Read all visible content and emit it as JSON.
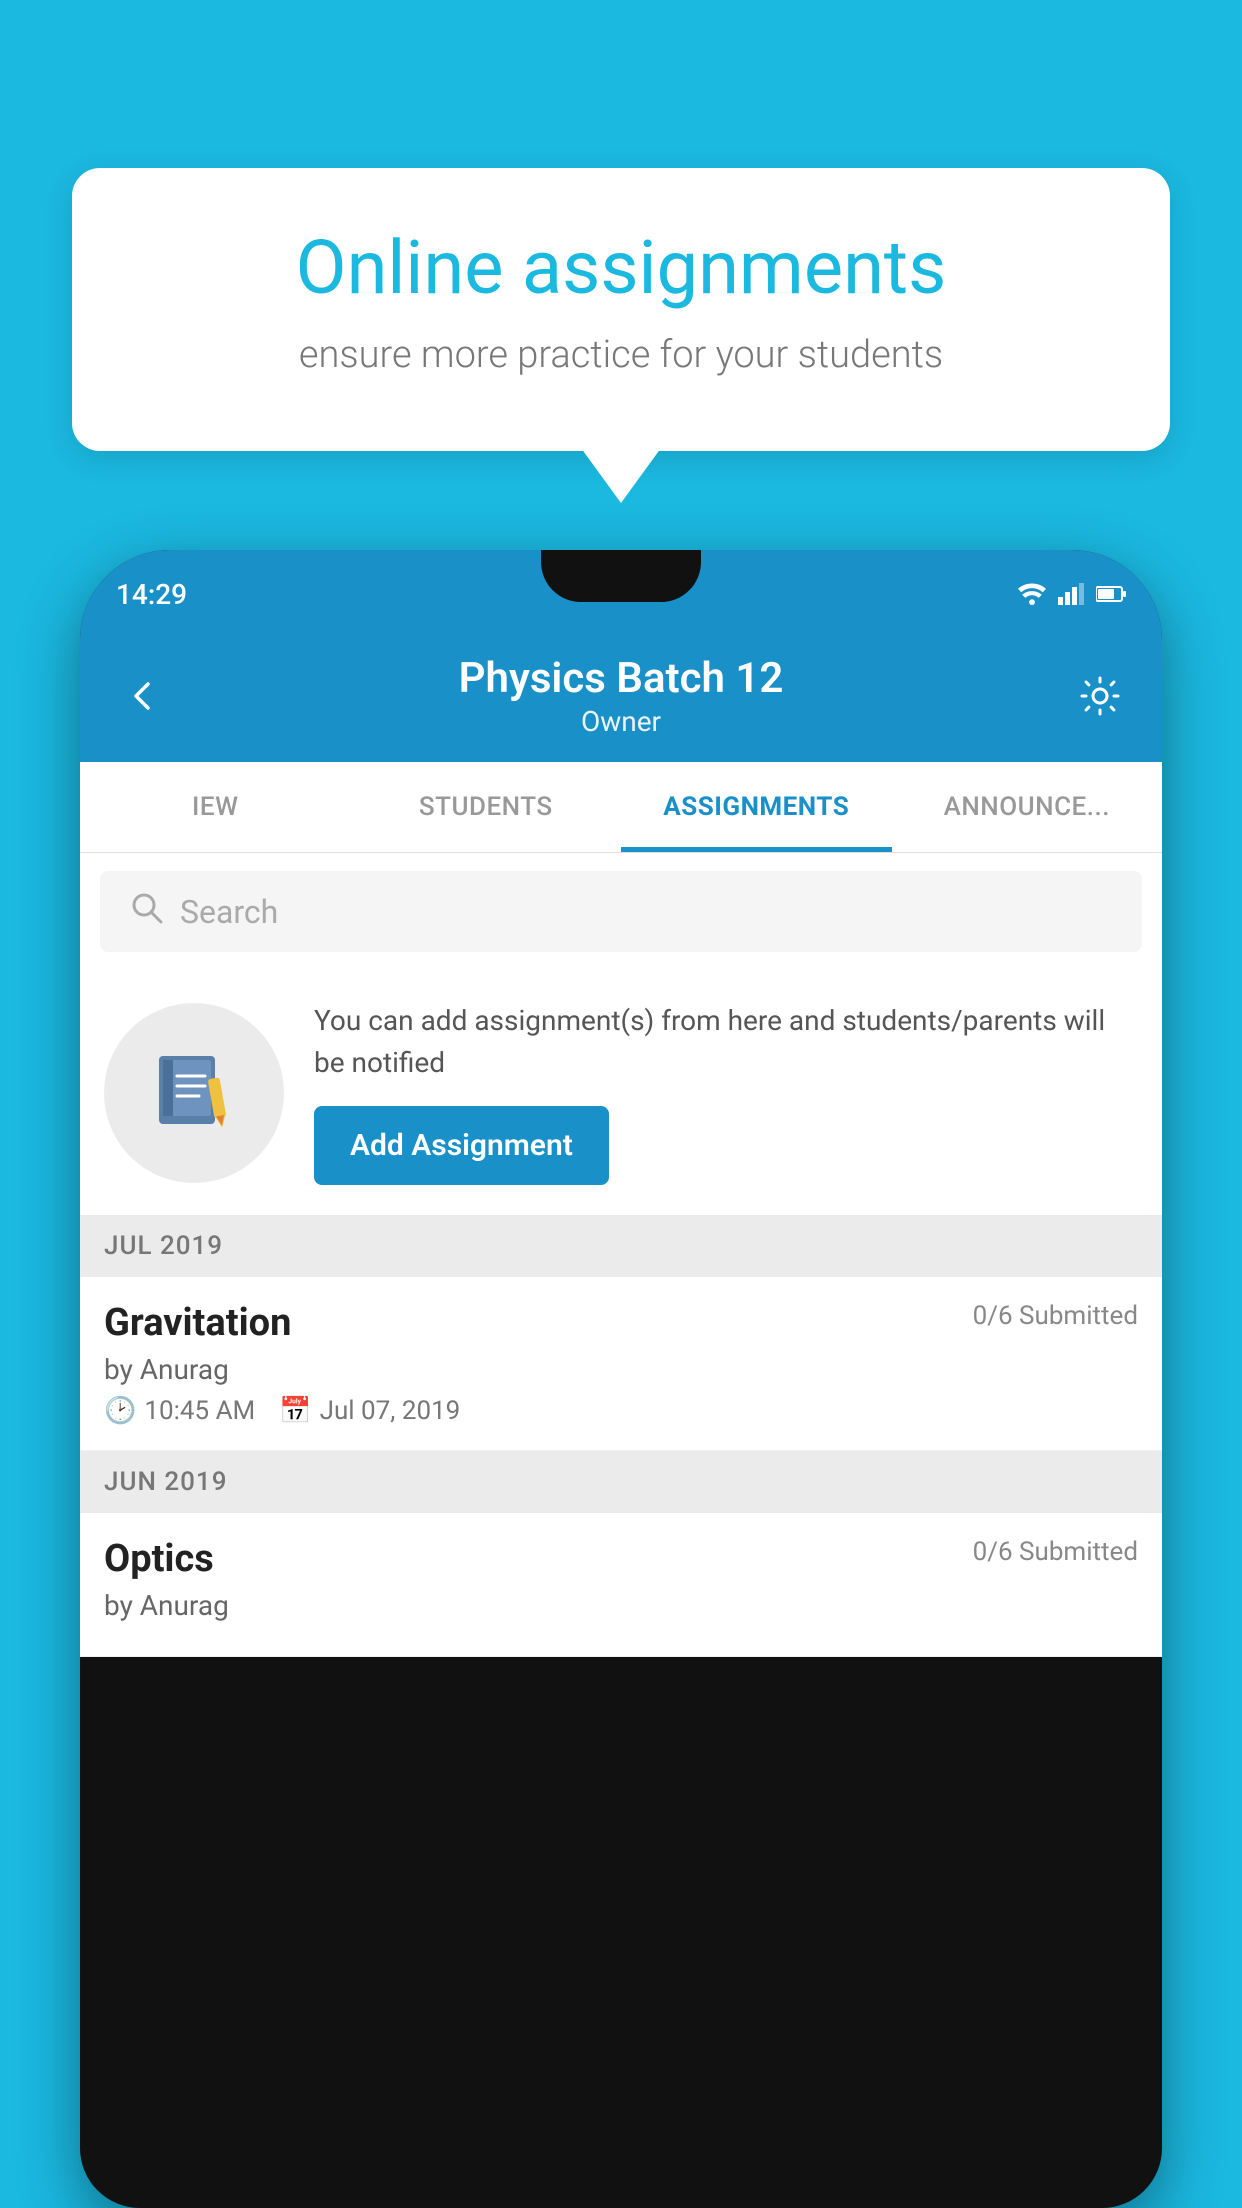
{
  "background_color": "#1bb8e0",
  "tooltip": {
    "title": "Online assignments",
    "subtitle": "ensure more practice for your students"
  },
  "phone": {
    "status_bar": {
      "time": "14:29"
    },
    "header": {
      "title": "Physics Batch 12",
      "subtitle": "Owner",
      "back_label": "←",
      "settings_label": "⚙"
    },
    "tabs": [
      {
        "label": "IEW",
        "active": false
      },
      {
        "label": "STUDENTS",
        "active": false
      },
      {
        "label": "ASSIGNMENTS",
        "active": true
      },
      {
        "label": "ANNOUNCE...",
        "active": false
      }
    ],
    "search": {
      "placeholder": "Search"
    },
    "promo": {
      "description": "You can add assignment(s) from here and students/parents will be notified",
      "button_label": "Add Assignment"
    },
    "sections": [
      {
        "header": "JUL 2019",
        "assignments": [
          {
            "name": "Gravitation",
            "submitted": "0/6 Submitted",
            "by": "by Anurag",
            "time": "10:45 AM",
            "date": "Jul 07, 2019"
          }
        ]
      },
      {
        "header": "JUN 2019",
        "assignments": [
          {
            "name": "Optics",
            "submitted": "0/6 Submitted",
            "by": "by Anurag",
            "time": "",
            "date": ""
          }
        ]
      }
    ]
  }
}
